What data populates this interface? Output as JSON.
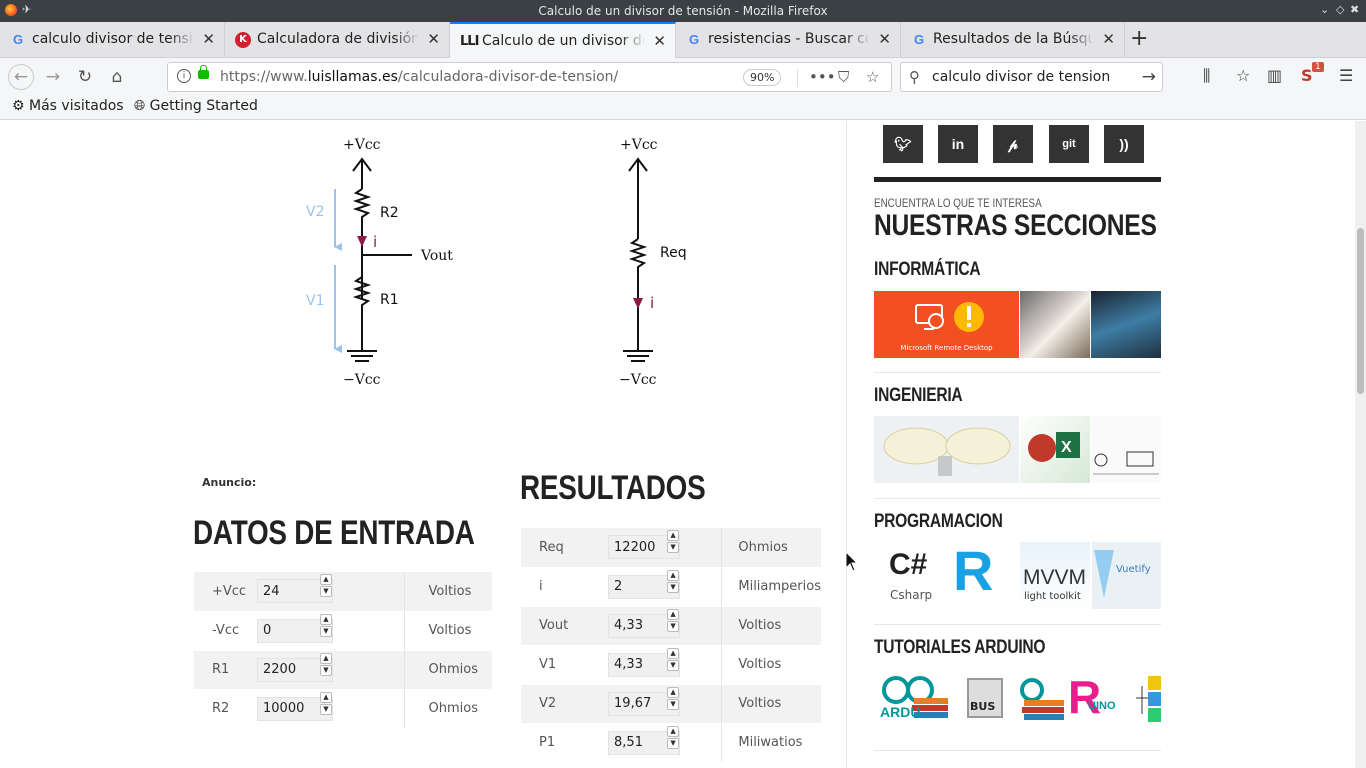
{
  "window": {
    "title": "Calculo de un divisor de tensión - Mozilla Firefox"
  },
  "tabs": [
    {
      "label": "calculo divisor de tension",
      "favicon": "google-g"
    },
    {
      "label": "Calculadora de división de tensión",
      "favicon": "k-logo"
    },
    {
      "label": "Calculo de un divisor de tensión",
      "favicon": "ll-logo",
      "active": true
    },
    {
      "label": "resistencias - Buscar con Google",
      "favicon": "google-g"
    },
    {
      "label": "Resultados de la Búsqueda",
      "favicon": "google-g"
    }
  ],
  "nav": {
    "url_prefix": "https://www.",
    "url_domain": "luisllamas.es",
    "url_path": "/calculadora-divisor-de-tension/",
    "zoom": "90%",
    "search_value": "calculo divisor de tension",
    "sync_badge": "1"
  },
  "bookmarks": [
    "Más visitados",
    "Getting Started"
  ],
  "diagram_left": {
    "top_label": "+Vcc",
    "bottom_label": "−Vcc",
    "r2": "R2",
    "r1": "R1",
    "current": "i",
    "vout": "Vout",
    "v2": "V2",
    "v1": "V1"
  },
  "diagram_right": {
    "top_label": "+Vcc",
    "bottom_label": "−Vcc",
    "req": "Req",
    "current": "i"
  },
  "ad_label": "Anuncio:",
  "inputs": {
    "heading": "DATOS DE ENTRADA",
    "rows": [
      {
        "label": "+Vcc",
        "value": "24",
        "unit": "Voltios"
      },
      {
        "label": "-Vcc",
        "value": "0",
        "unit": "Voltios"
      },
      {
        "label": "R1",
        "value": "2200",
        "unit": "Ohmios"
      },
      {
        "label": "R2",
        "value": "10000",
        "unit": "Ohmios"
      }
    ]
  },
  "results": {
    "heading": "RESULTADOS",
    "rows": [
      {
        "label": "Req",
        "value": "12200",
        "unit": "Ohmios"
      },
      {
        "label": "i",
        "value": "2",
        "unit": "Miliamperios"
      },
      {
        "label": "Vout",
        "value": "4,33",
        "unit": "Voltios"
      },
      {
        "label": "V1",
        "value": "4,33",
        "unit": "Voltios"
      },
      {
        "label": "V2",
        "value": "19,67",
        "unit": "Voltios"
      },
      {
        "label": "P1",
        "value": "8,51",
        "unit": "Miliwatios"
      }
    ]
  },
  "sidebar": {
    "social": [
      "twitter-icon",
      "linkedin-icon",
      "pinterest-icon",
      "git",
      "rss-icon"
    ],
    "social_git_label": "git",
    "kicker": "ENCUENTRA LO QUE TE INTERESA",
    "heading": "NUESTRAS SECCIONES",
    "sections": [
      {
        "title": "INFORMÁTICA",
        "thumb1_caption": "Microsoft Remote Desktop"
      },
      {
        "title": "INGENIERIA"
      },
      {
        "title": "PROGRAMACION",
        "thumbs": [
          "C#",
          "Csharp",
          "R",
          "MVVM",
          "light toolkit",
          "Vuetify"
        ]
      },
      {
        "title": "TUTORIALES ARDUINO",
        "thumbs": [
          "ARDU",
          "BUS",
          "UINO"
        ]
      }
    ]
  },
  "colors": {
    "accent": "#0a84ff",
    "current_arrow": "#8b1a4a",
    "voltage_arrow": "#9cc3ec",
    "dark": "#222222"
  }
}
